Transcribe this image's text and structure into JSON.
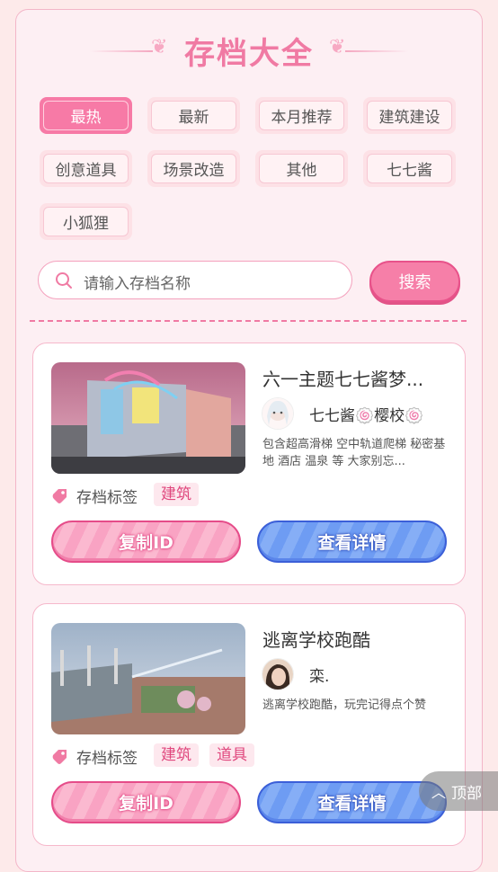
{
  "header": {
    "title": "存档大全"
  },
  "tabs": [
    {
      "label": "最热",
      "active": true
    },
    {
      "label": "最新",
      "active": false
    },
    {
      "label": "本月推荐",
      "active": false
    },
    {
      "label": "建筑建设",
      "active": false
    },
    {
      "label": "创意道具",
      "active": false
    },
    {
      "label": "场景改造",
      "active": false
    },
    {
      "label": "其他",
      "active": false
    },
    {
      "label": "七七酱",
      "active": false
    },
    {
      "label": "小狐狸",
      "active": false
    }
  ],
  "search": {
    "placeholder": "请输入存档名称",
    "button_label": "搜索",
    "icon": "search-icon"
  },
  "cards": [
    {
      "title": "六一主题七七酱梦...",
      "author": "七七酱🍥樱校🍥",
      "description": "包含超高滑梯 空中轨道爬梯 秘密基地 酒店 温泉 等 大家别忘...",
      "tag_label": "存档标签",
      "tags": [
        "建筑"
      ],
      "copy_label": "复制ID",
      "detail_label": "查看详情"
    },
    {
      "title": "逃离学校跑酷",
      "author": "栾.",
      "description": "逃离学校跑酷，玩完记得点个赞",
      "tag_label": "存档标签",
      "tags": [
        "建筑",
        "道具"
      ],
      "copy_label": "复制ID",
      "detail_label": "查看详情"
    }
  ],
  "back_to_top": {
    "label": "顶部",
    "icon": "chevron-up-icon"
  },
  "colors": {
    "accent_pink": "#f77aa6",
    "accent_blue": "#6e9cf3",
    "background": "#fdeaea"
  }
}
